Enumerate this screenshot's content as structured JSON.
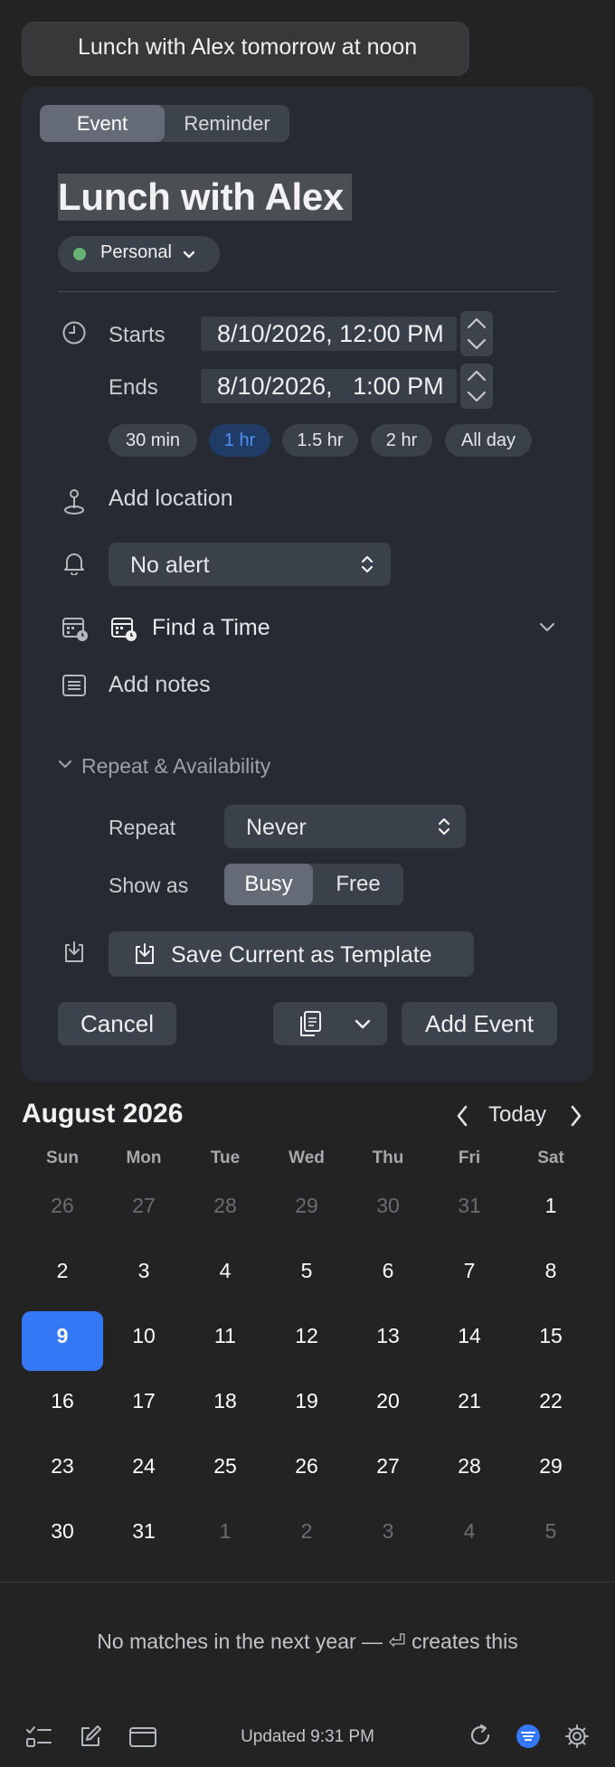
{
  "query": {
    "text": "Lunch with Alex tomorrow at noon"
  },
  "form": {
    "tabs": [
      {
        "label": "Event",
        "active": true
      },
      {
        "label": "Reminder",
        "active": false
      }
    ],
    "title": "Lunch with Alex",
    "calendar": {
      "name": "Personal",
      "color": "#67b374"
    },
    "starts": {
      "label": "Starts",
      "value": "8/10/2026, 12:00 PM"
    },
    "ends": {
      "label": "Ends",
      "value": "8/10/2026,   1:00 PM"
    },
    "durations": [
      {
        "label": "30 min",
        "active": false
      },
      {
        "label": "1 hr",
        "active": true
      },
      {
        "label": "1.5 hr",
        "active": false
      },
      {
        "label": "2 hr",
        "active": false
      },
      {
        "label": "All day",
        "active": false
      }
    ],
    "location_placeholder": "Add location",
    "alert": {
      "value": "No alert"
    },
    "find_time": {
      "label": "Find a Time"
    },
    "notes_placeholder": "Add notes",
    "repeat_section": {
      "title": "Repeat & Availability",
      "repeat_label": "Repeat",
      "repeat_value": "Never",
      "show_as_label": "Show as",
      "show_as_options": [
        {
          "label": "Busy",
          "active": true
        },
        {
          "label": "Free",
          "active": false
        }
      ]
    },
    "template_button": "Save Current as Template",
    "cancel_button": "Cancel",
    "add_button": "Add Event"
  },
  "calendar": {
    "month": "August 2026",
    "today_label": "Today",
    "weekdays": [
      "Sun",
      "Mon",
      "Tue",
      "Wed",
      "Thu",
      "Fri",
      "Sat"
    ],
    "weeks": [
      [
        "26",
        "27",
        "28",
        "29",
        "30",
        "31",
        "1"
      ],
      [
        "2",
        "3",
        "4",
        "5",
        "6",
        "7",
        "8"
      ],
      [
        "9",
        "10",
        "11",
        "12",
        "13",
        "14",
        "15"
      ],
      [
        "16",
        "17",
        "18",
        "19",
        "20",
        "21",
        "22"
      ],
      [
        "23",
        "24",
        "25",
        "26",
        "27",
        "28",
        "29"
      ],
      [
        "30",
        "31",
        "1",
        "2",
        "3",
        "4",
        "5"
      ]
    ],
    "selected_day": "9"
  },
  "status": {
    "no_matches": "No matches in the next year — ⏎ creates this",
    "updated": "Updated 9:31 PM"
  },
  "colors": {
    "accent": "#3478f6",
    "panel": "#262b33",
    "background": "#232324"
  }
}
